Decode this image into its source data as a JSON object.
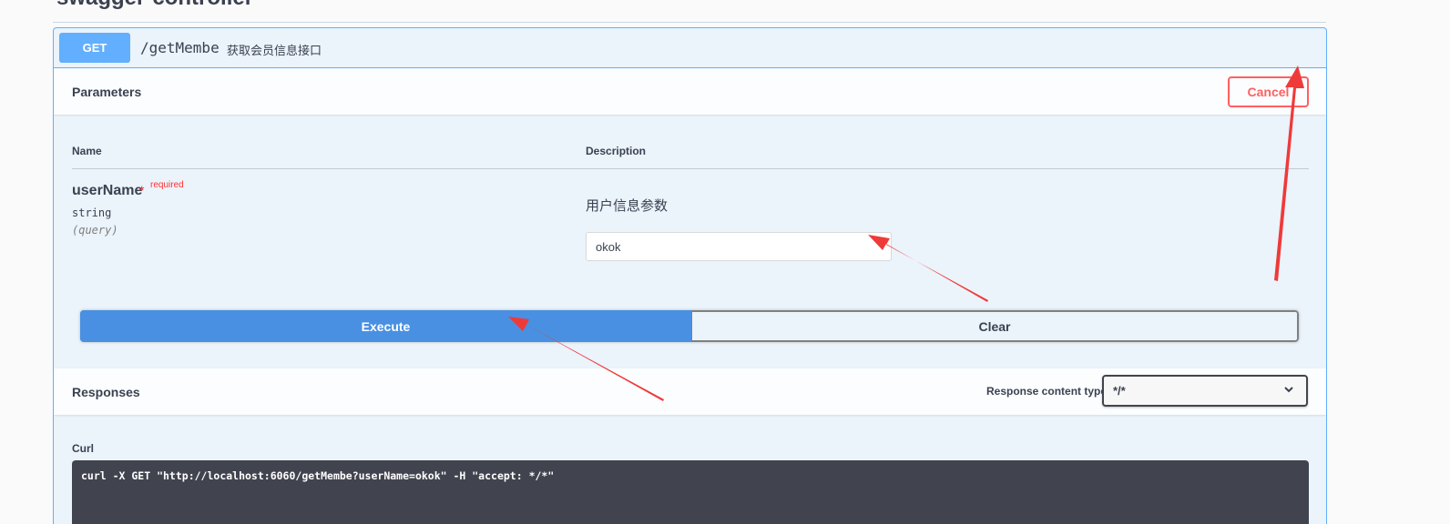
{
  "controller": {
    "title": "swagger-controller"
  },
  "operation": {
    "method": "GET",
    "path": "/getMembe",
    "summary": "获取会员信息接口"
  },
  "parameters": {
    "title": "Parameters",
    "cancel_label": "Cancel",
    "col_name": "Name",
    "col_description": "Description",
    "items": [
      {
        "name": "userName",
        "required_star": "*",
        "required_label": "required",
        "type": "string",
        "in": "(query)",
        "description": "用户信息参数",
        "value": "okok"
      }
    ]
  },
  "actions": {
    "execute_label": "Execute",
    "clear_label": "Clear"
  },
  "responses": {
    "title": "Responses",
    "content_type_label": "Response content type",
    "content_type_value": "*/*"
  },
  "curl": {
    "label": "Curl",
    "command": "curl -X GET \"http://localhost:6060/getMembe?userName=okok\" -H \"accept: */*\""
  },
  "colors": {
    "get_method": "#61affe",
    "execute": "#4990e2",
    "cancel": "#ff6060",
    "annotation_arrow": "#ef3a3a"
  }
}
